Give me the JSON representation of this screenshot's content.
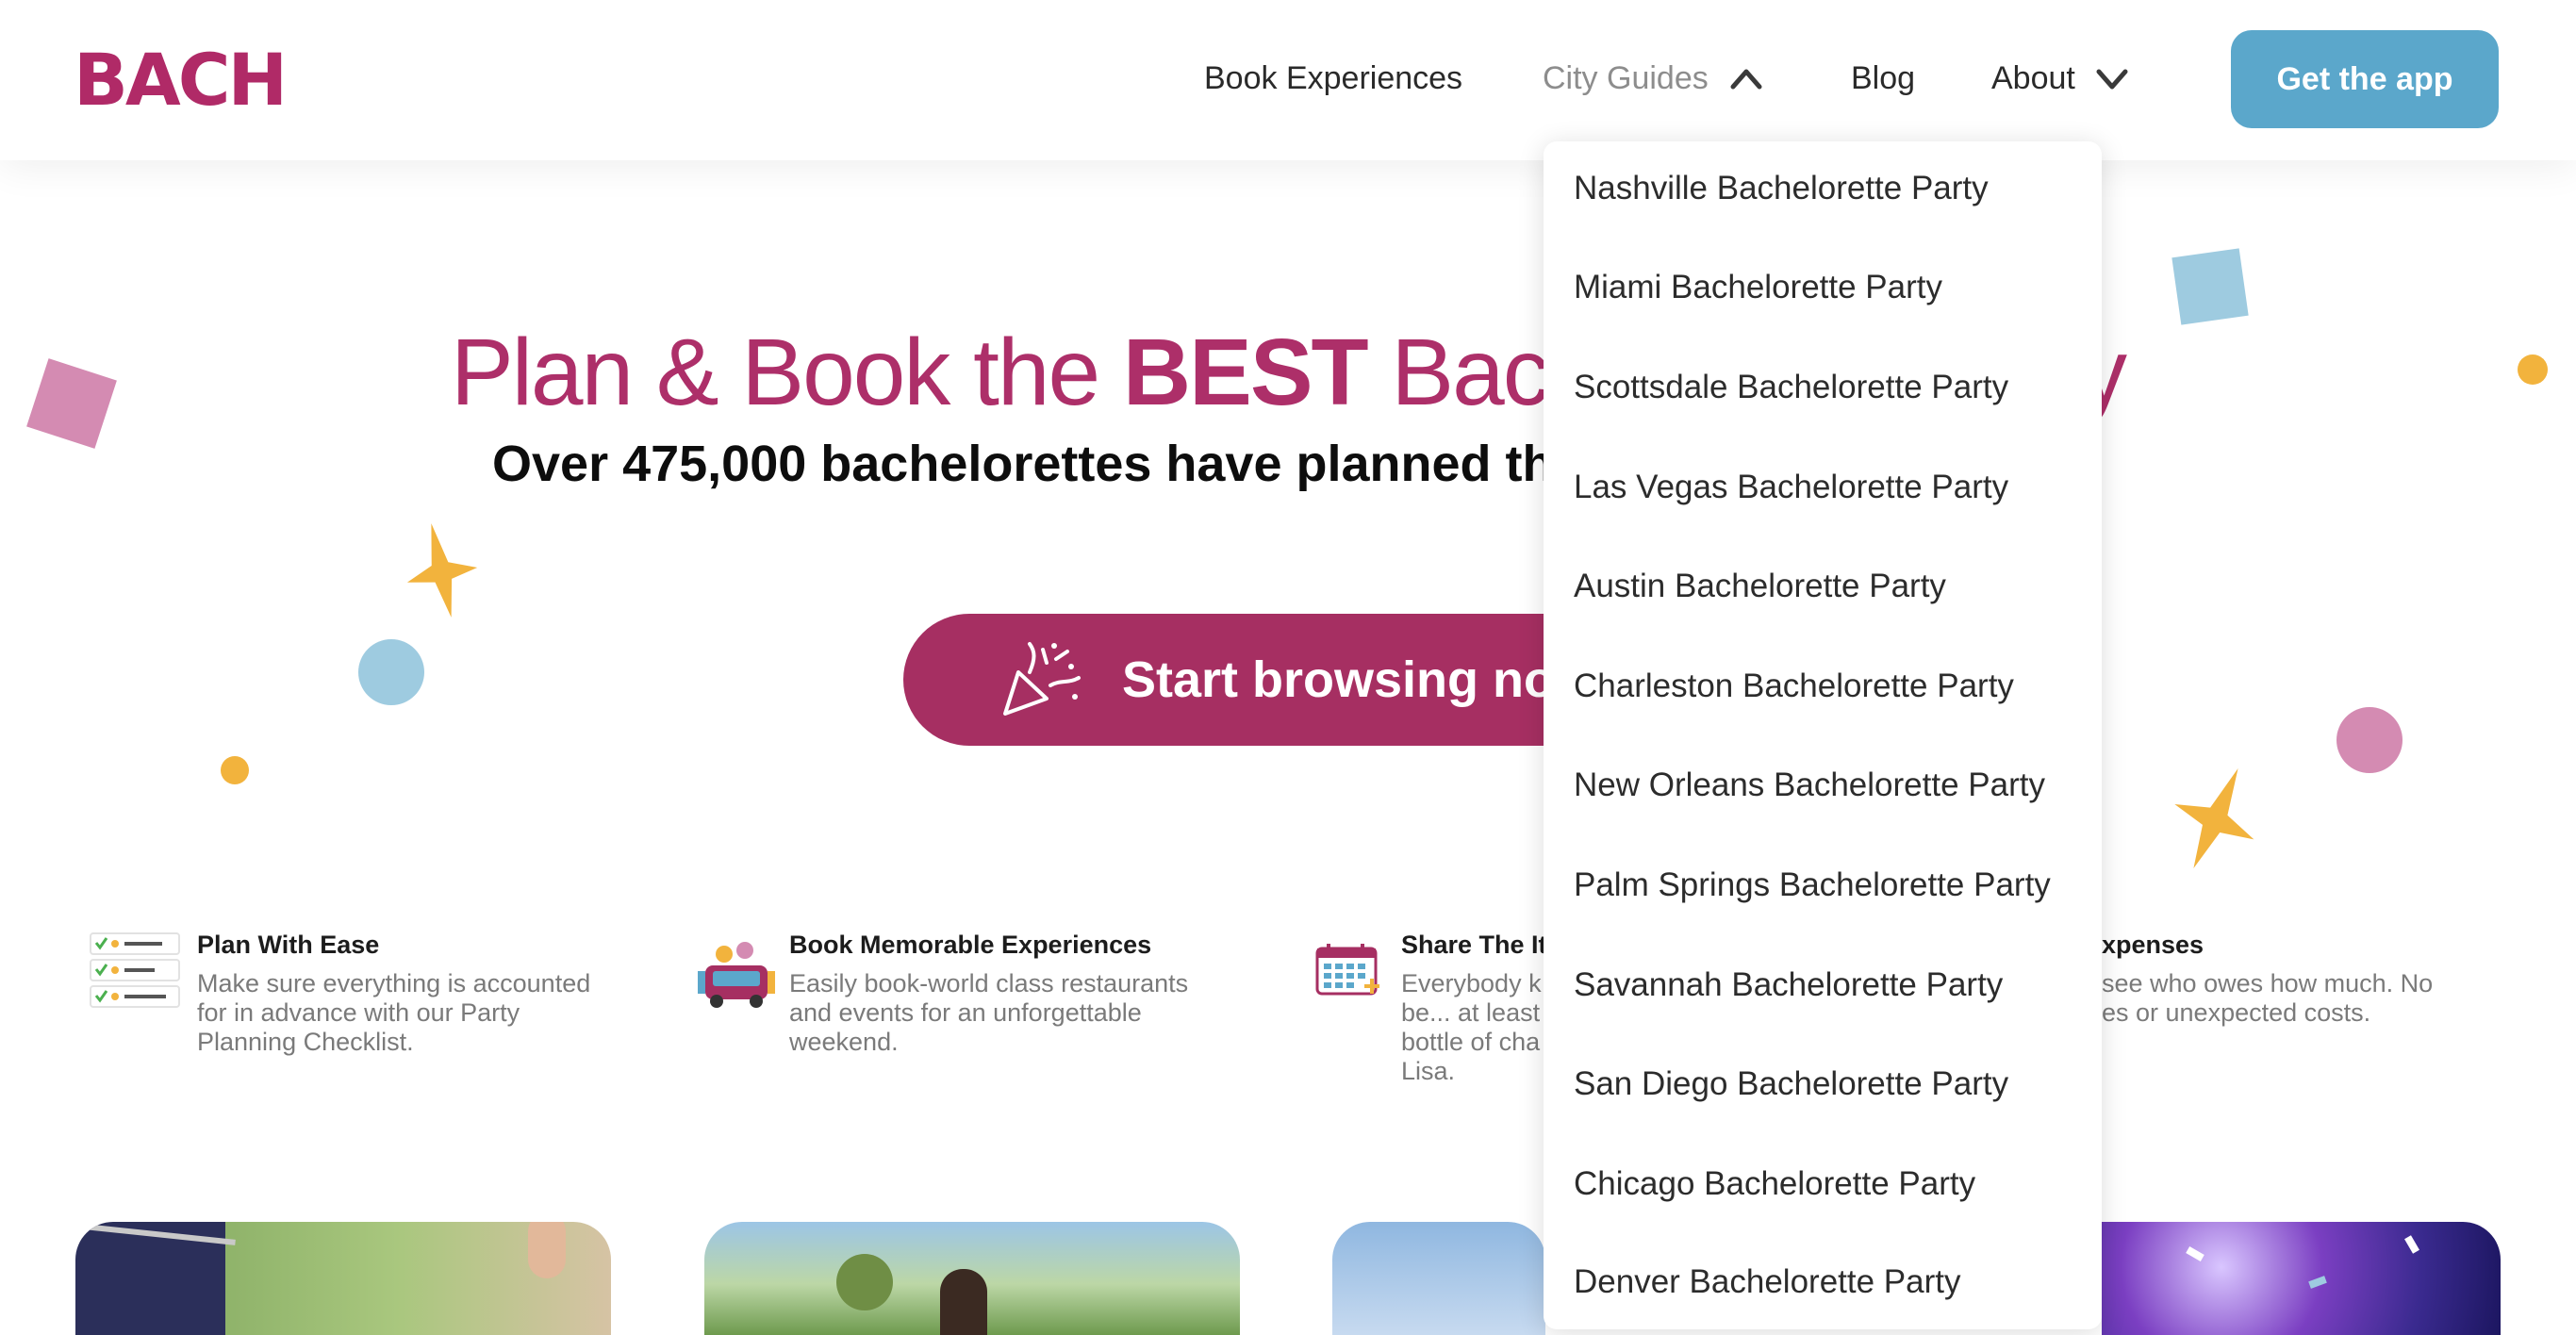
{
  "header": {
    "logo": "BACH",
    "nav": {
      "book": "Book Experiences",
      "city_guides": "City Guides",
      "blog": "Blog",
      "about": "About"
    },
    "cta": "Get the app"
  },
  "hero": {
    "title_part1": "Plan & Book the ",
    "title_bold": "BEST",
    "title_part2": " Bach",
    "title_tail": "y",
    "subtitle": "Over 475,000 bachelorettes have planned th",
    "browse_label": "Start browsing now"
  },
  "features": [
    {
      "title": "Plan With Ease",
      "lines": [
        "Make sure everything is accounted",
        "for in advance with our Party",
        "Planning Checklist."
      ],
      "icon": "checklist-icon"
    },
    {
      "title": "Book Memorable Experiences",
      "lines": [
        "Easily book-world class restaurants",
        "and events for an unforgettable",
        "weekend."
      ],
      "icon": "party-bus-icon"
    },
    {
      "title": "Share The It",
      "lines": [
        "Everybody k",
        "be... at least",
        "bottle of cha",
        "Lisa."
      ],
      "icon": "calendar-icon"
    },
    {
      "title": "xpenses",
      "lines": [
        "see who owes how much. No",
        "es or unexpected costs."
      ],
      "icon": ""
    }
  ],
  "dropdown": {
    "items": [
      "Nashville Bachelorette Party",
      "Miami Bachelorette Party",
      "Scottsdale Bachelorette Party",
      "Las Vegas Bachelorette Party",
      "Austin Bachelorette Party",
      "Charleston Bachelorette Party",
      "New Orleans Bachelorette Party",
      "Palm Springs Bachelorette Party",
      "Savannah Bachelorette Party",
      "San Diego Bachelorette Party",
      "Chicago Bachelorette Party",
      "Denver Bachelorette Party"
    ]
  },
  "colors": {
    "brand": "#b02a67",
    "cta_blue": "#5ba7cb",
    "browse_bg": "#a62f62",
    "confetti_yellow": "#f2b33d",
    "confetti_blue": "#9ecbe0",
    "confetti_pink": "#d48bb2"
  }
}
